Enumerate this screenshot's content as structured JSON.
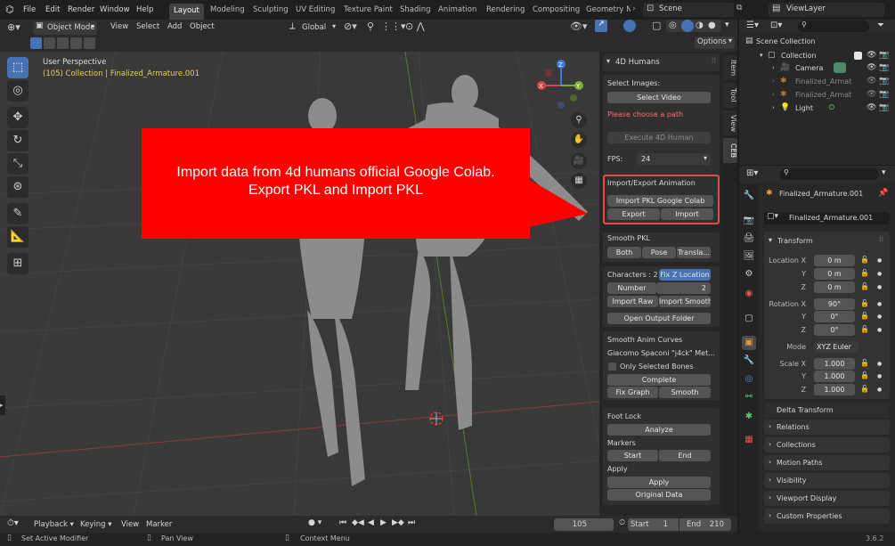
{
  "topbar": {
    "menus": [
      "File",
      "Edit",
      "Render",
      "Window",
      "Help"
    ],
    "workspaces": [
      "Layout",
      "Modeling",
      "Sculpting",
      "UV Editing",
      "Texture Paint",
      "Shading",
      "Animation",
      "Rendering",
      "Compositing",
      "Geometry No"
    ],
    "active_workspace": "Layout",
    "scene": "Scene",
    "view_layer": "ViewLayer"
  },
  "viewport_header": {
    "mode": "Object Mode",
    "menus": [
      "View",
      "Select",
      "Add",
      "Object"
    ],
    "orientation": "Global",
    "options": "Options"
  },
  "viewport": {
    "perspective": "User Perspective",
    "collection_info": "(105) Collection | Finalized_Armature.001",
    "annotation": "Import data from 4d humans official Google Colab.\nExport PKL and Import PKL",
    "annotation_color": "#ff0000",
    "gizmo": {
      "x": "X",
      "y": "Y",
      "z": "Z"
    }
  },
  "npanel": {
    "header": "4D Humans",
    "tabs": [
      "Item",
      "Tool",
      "View",
      "CEB"
    ],
    "active_tab": "CEB",
    "select_images_label": "Select Images:",
    "select_video": "Select Video",
    "warning": "Please choose a path",
    "execute": "Execute 4D Human",
    "fps_label": "FPS:",
    "fps_value": "24",
    "import_export_label": "Import/Export Animation",
    "import_pkl_colab": "Import PKL Google Colab",
    "export": "Export",
    "import": "Import",
    "smooth_pkl_label": "Smooth PKL",
    "both": "Both",
    "pose": "Pose",
    "transla": "Transla...",
    "characters_label": "Characters : 2",
    "fix_z": "Fix Z Location",
    "number_label": "Number",
    "number_value": "2",
    "import_raw": "Import Raw",
    "import_smooth": "Import Smooth",
    "open_output": "Open Output Folder",
    "smooth_curves_label": "Smooth Anim Curves",
    "method": "Giacomo Spaconi \"j4ck\" Met...",
    "only_selected": "Only Selected Bones",
    "complete": "Complete",
    "fix_graph": "Fix Graph",
    "smooth": "Smooth",
    "foot_lock_label": "Foot Lock",
    "analyze": "Analyze",
    "markers_label": "Markers",
    "start": "Start",
    "end": "End",
    "apply_label": "Apply",
    "apply": "Apply",
    "original_data": "Original Data"
  },
  "outliner": {
    "scene_collection": "Scene Collection",
    "items": [
      {
        "name": "Collection",
        "indent": 0
      },
      {
        "name": "Camera",
        "indent": 1
      },
      {
        "name": "Finalized_Armat",
        "indent": 1
      },
      {
        "name": "Finalized_Armat",
        "indent": 1
      },
      {
        "name": "Light",
        "indent": 1
      }
    ]
  },
  "properties": {
    "object_name": "Finalized_Armature.001",
    "datablock": "Finalized_Armature.001",
    "transform_label": "Transform",
    "location_label": "Location X",
    "location": [
      "0 m",
      "0 m",
      "0 m"
    ],
    "rotation_label": "Rotation X",
    "rotation": [
      "90°",
      "0°",
      "0°"
    ],
    "mode_label": "Mode",
    "mode_value": "XYZ Euler",
    "scale_label": "Scale X",
    "scale": [
      "1.000",
      "1.000",
      "1.000"
    ],
    "axes": [
      "Y",
      "Z"
    ],
    "delta": "Delta Transform",
    "sections": [
      "Relations",
      "Collections",
      "Motion Paths",
      "Visibility",
      "Viewport Display",
      "Custom Properties"
    ]
  },
  "timeline": {
    "menus": [
      "Playback",
      "Keying",
      "View",
      "Marker"
    ],
    "current_frame": "105",
    "start_label": "Start",
    "start": "1",
    "end_label": "End",
    "end": "210"
  },
  "statusbar": {
    "items": [
      "Set Active Modifier",
      "Pan View",
      "Context Menu"
    ],
    "version": "3.6.2"
  }
}
